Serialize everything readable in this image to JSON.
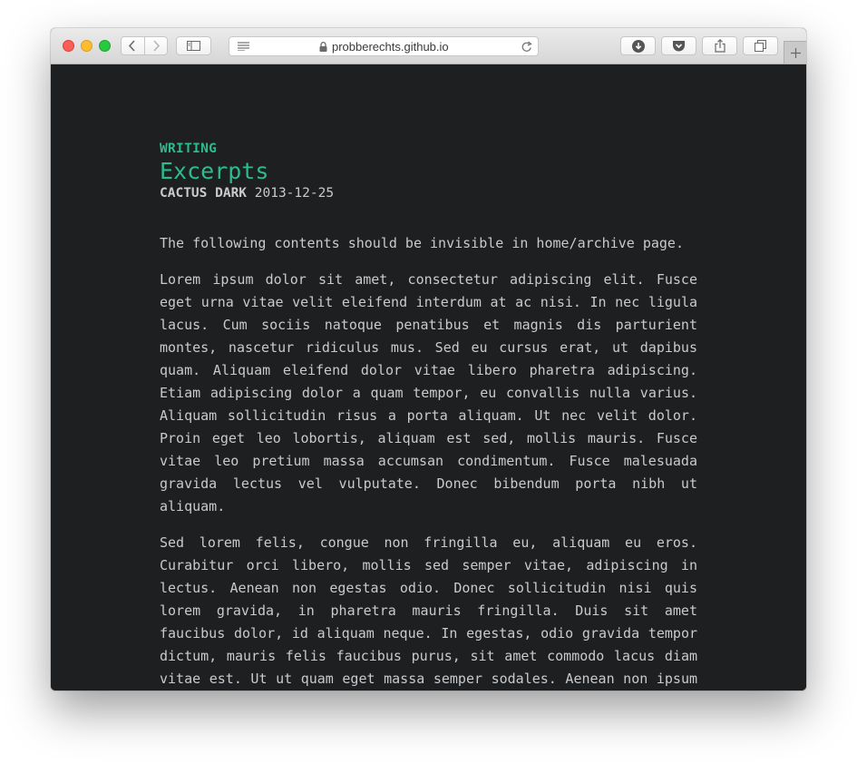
{
  "browser": {
    "url": "probberechts.github.io"
  },
  "post": {
    "section": "WRITING",
    "title": "Excerpts",
    "author": "CACTUS DARK",
    "date": "2013-12-25",
    "paragraphs": [
      "The following contents should be invisible in home/archive page.",
      "Lorem ipsum dolor sit amet, consectetur adipiscing elit. Fusce eget urna vitae velit eleifend interdum at ac nisi. In nec ligula lacus. Cum sociis natoque penatibus et magnis dis parturient montes, nascetur ridiculus mus. Sed eu cursus erat, ut dapibus quam. Aliquam eleifend dolor vitae libero pharetra adipiscing. Etiam adipiscing dolor a quam tempor, eu convallis nulla varius. Aliquam sollicitudin risus a porta aliquam. Ut nec velit dolor. Proin eget leo lobortis, aliquam est sed, mollis mauris. Fusce vitae leo pretium massa accumsan condimentum. Fusce malesuada gravida lectus vel vulputate. Donec bibendum porta nibh ut aliquam.",
      "Sed lorem felis, congue non fringilla eu, aliquam eu eros. Curabitur orci libero, mollis sed semper vitae, adipiscing in lectus. Aenean non egestas odio. Donec sollicitudin nisi quis lorem gravida, in pharetra mauris fringilla. Duis sit amet faucibus dolor, id aliquam neque. In egestas, odio gravida tempor dictum, mauris felis faucibus purus, sit amet commodo lacus diam vitae est. Ut ut quam eget massa semper sodales. Aenean non ipsum cursus, blandit lectus in, ornare odio."
    ]
  },
  "colors": {
    "accent": "#2bbc8a",
    "background": "#1d1f21",
    "text": "#c9cacc"
  }
}
